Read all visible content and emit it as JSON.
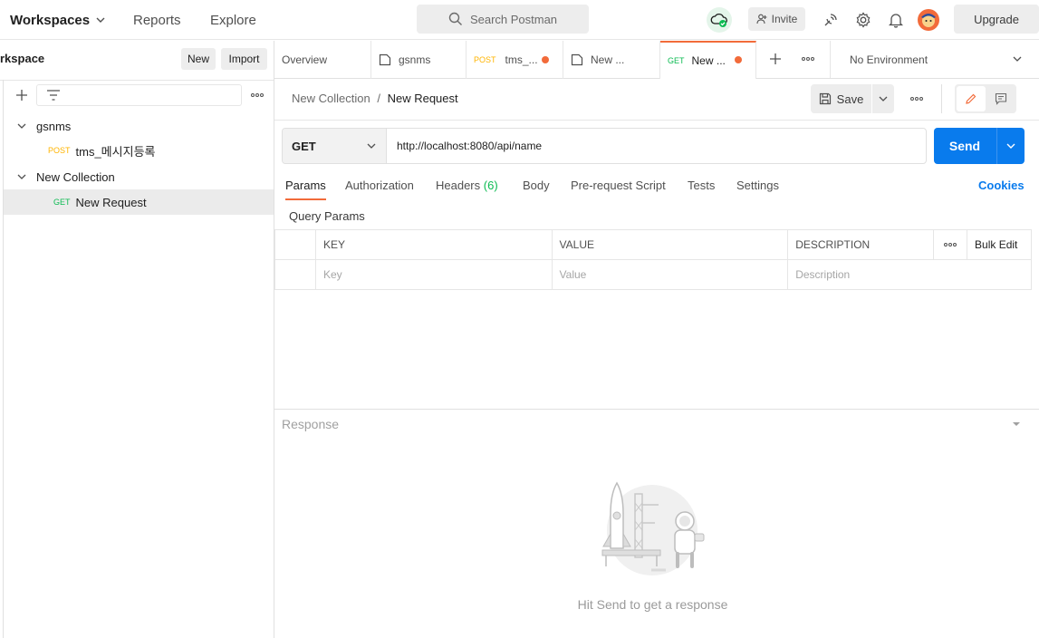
{
  "topbar": {
    "workspaces": "Workspaces",
    "reports": "Reports",
    "explore": "Explore",
    "search_placeholder": "Search Postman",
    "invite": "Invite",
    "upgrade": "Upgrade"
  },
  "sidebar": {
    "title": "rkspace",
    "new_button": "New",
    "import_button": "Import",
    "collections": [
      {
        "name": "gsnms",
        "requests": [
          {
            "method": "POST",
            "name": "tms_메시지등록"
          }
        ]
      },
      {
        "name": "New Collection",
        "requests": [
          {
            "method": "GET",
            "name": "New Request"
          }
        ]
      }
    ]
  },
  "tabs": [
    {
      "label": "Overview",
      "method": "",
      "unsaved": false
    },
    {
      "label": "gsnms",
      "method": "",
      "unsaved": false
    },
    {
      "label": "tms_...",
      "method": "POST",
      "unsaved": true
    },
    {
      "label": "New ...",
      "method": "",
      "unsaved": false
    },
    {
      "label": "New ...",
      "method": "GET",
      "unsaved": true
    }
  ],
  "environment": "No Environment",
  "breadcrumb": {
    "collection": "New Collection",
    "separator": "/",
    "request": "New Request"
  },
  "save_label": "Save",
  "request": {
    "method": "GET",
    "url": "http://localhost:8080/api/name",
    "send_label": "Send"
  },
  "request_tabs": {
    "params": "Params",
    "authorization": "Authorization",
    "headers": "Headers",
    "headers_count": "(6)",
    "body": "Body",
    "prerequest": "Pre-request Script",
    "tests": "Tests",
    "settings": "Settings",
    "cookies": "Cookies"
  },
  "query_params": {
    "title": "Query Params",
    "columns": {
      "key": "KEY",
      "value": "VALUE",
      "description": "DESCRIPTION"
    },
    "bulk_edit": "Bulk Edit",
    "placeholders": {
      "key": "Key",
      "value": "Value",
      "description": "Description"
    }
  },
  "response": {
    "title": "Response",
    "empty_text": "Hit Send to get a response"
  },
  "colors": {
    "accent": "#f26b3a",
    "send_blue": "#097bed",
    "post_orange": "#ffb400",
    "get_green": "#0cbb52",
    "sync_green": "#0cbb52"
  }
}
